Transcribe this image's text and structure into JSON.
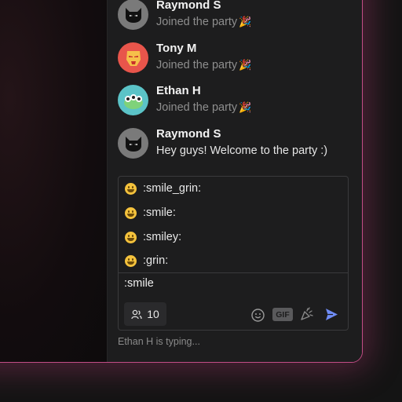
{
  "messages": [
    {
      "name": "Raymond S",
      "text": "Joined the party",
      "emoji": "🎉",
      "avatar": "batman-icon",
      "avatar_bg": "#7a7a7a"
    },
    {
      "name": "Tony M",
      "text": "Joined the party",
      "emoji": "🎉",
      "avatar": "ironman-icon",
      "avatar_bg": "#e8554b"
    },
    {
      "name": "Ethan H",
      "text": "Joined the party",
      "emoji": "🎉",
      "avatar": "alien-icon",
      "avatar_bg": "#5bc3c7"
    },
    {
      "name": "Raymond S",
      "text": "Hey guys! Welcome to the party :)",
      "avatar": "batman-icon",
      "avatar_bg": "#7a7a7a"
    }
  ],
  "emoji_suggestions": [
    {
      "code": ":smile_grin:",
      "icon": "grin-emoji-icon"
    },
    {
      "code": ":smile:",
      "icon": "smile-emoji-icon"
    },
    {
      "code": ":smiley:",
      "icon": "smiley-emoji-icon"
    },
    {
      "code": ":grin:",
      "icon": "grin-emoji-icon"
    }
  ],
  "composer": {
    "value": ":smile",
    "members_count": "10",
    "gif_label": "GIF"
  },
  "status": {
    "typing": "Ethan H is typing..."
  },
  "colors": {
    "accent": "#6f8cf6",
    "border_glow": "#c24d86"
  }
}
